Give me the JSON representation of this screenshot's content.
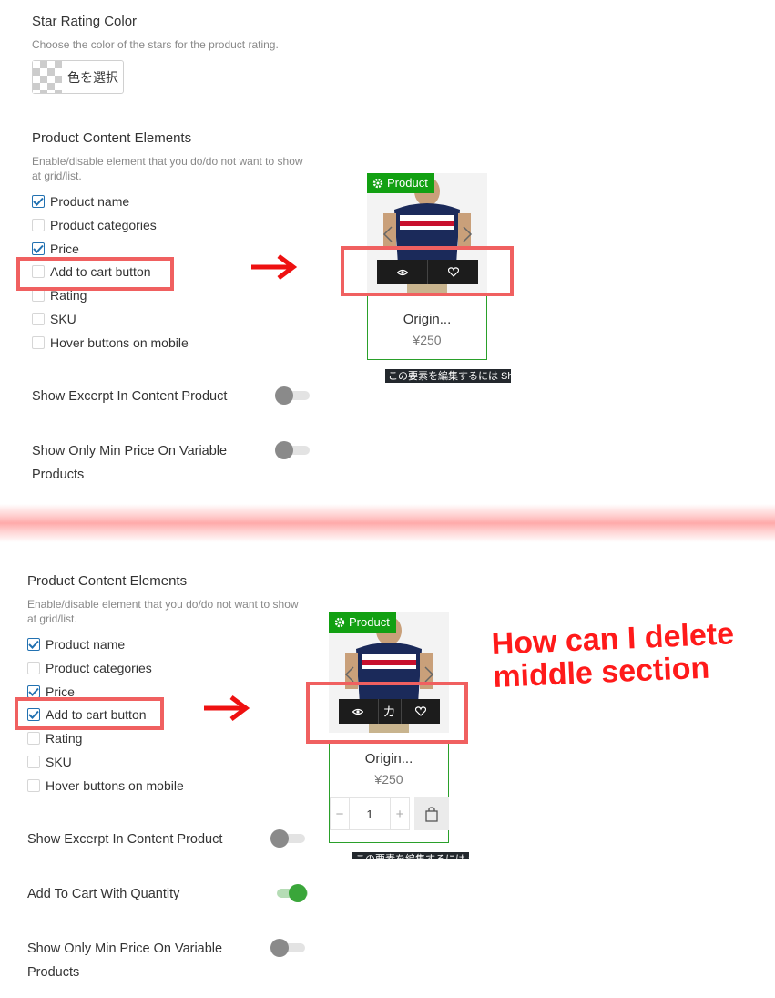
{
  "top": {
    "star_rating": {
      "title": "Star Rating Color",
      "desc": "Choose the color of the stars for the product rating.",
      "color_button_label": "色を選択"
    },
    "content_elements": {
      "title": "Product Content Elements",
      "desc_line1": "Enable/disable element that you do/do not want to show",
      "desc_line2": "at grid/list.",
      "items": [
        {
          "label": "Product name",
          "checked": true
        },
        {
          "label": "Product categories",
          "checked": false
        },
        {
          "label": "Price",
          "checked": true
        },
        {
          "label": "Add to cart button",
          "checked": false
        },
        {
          "label": "Rating",
          "checked": false
        },
        {
          "label": "SKU",
          "checked": false
        },
        {
          "label": "Hover buttons on mobile",
          "checked": false
        }
      ]
    },
    "toggles": [
      {
        "label": "Show Excerpt In Content Product",
        "on": false
      },
      {
        "label_line1": "Show Only Min Price On Variable",
        "label_line2": "Products",
        "on": false
      }
    ],
    "preview": {
      "badge": "Product",
      "name": "Origin...",
      "price": "¥250",
      "tooltip": "この要素を編集するには Sh"
    }
  },
  "bottom": {
    "content_elements": {
      "title": "Product Content Elements",
      "desc_line1": "Enable/disable element that you do/do not want to show",
      "desc_line2": "at grid/list.",
      "items": [
        {
          "label": "Product name",
          "checked": true
        },
        {
          "label": "Product categories",
          "checked": false
        },
        {
          "label": "Price",
          "checked": true
        },
        {
          "label": "Add to cart button",
          "checked": true
        },
        {
          "label": "Rating",
          "checked": false
        },
        {
          "label": "SKU",
          "checked": false
        },
        {
          "label": "Hover buttons on mobile",
          "checked": false
        }
      ]
    },
    "toggles": [
      {
        "label": "Show Excerpt In Content Product",
        "on": false
      },
      {
        "label": "Add To Cart With Quantity",
        "on": true
      },
      {
        "label_line1": "Show Only Min Price On Variable",
        "label_line2": "Products",
        "on": false
      }
    ],
    "preview": {
      "badge": "Product",
      "name": "Origin...",
      "price": "¥250",
      "qty_minus": "−",
      "qty_value": "1",
      "qty_plus": "+",
      "middle_glyph": "カ",
      "tooltip": "この要素を編集するには Sh"
    },
    "annotation_line1": "How can I delete",
    "annotation_line2": "middle section"
  },
  "colors": {
    "annotation_red": "#ff1a1a",
    "box_red": "#f06060",
    "badge_green": "#12a012",
    "checkbox_blue": "#2271b1",
    "toggle_on": "#3aa63a"
  }
}
